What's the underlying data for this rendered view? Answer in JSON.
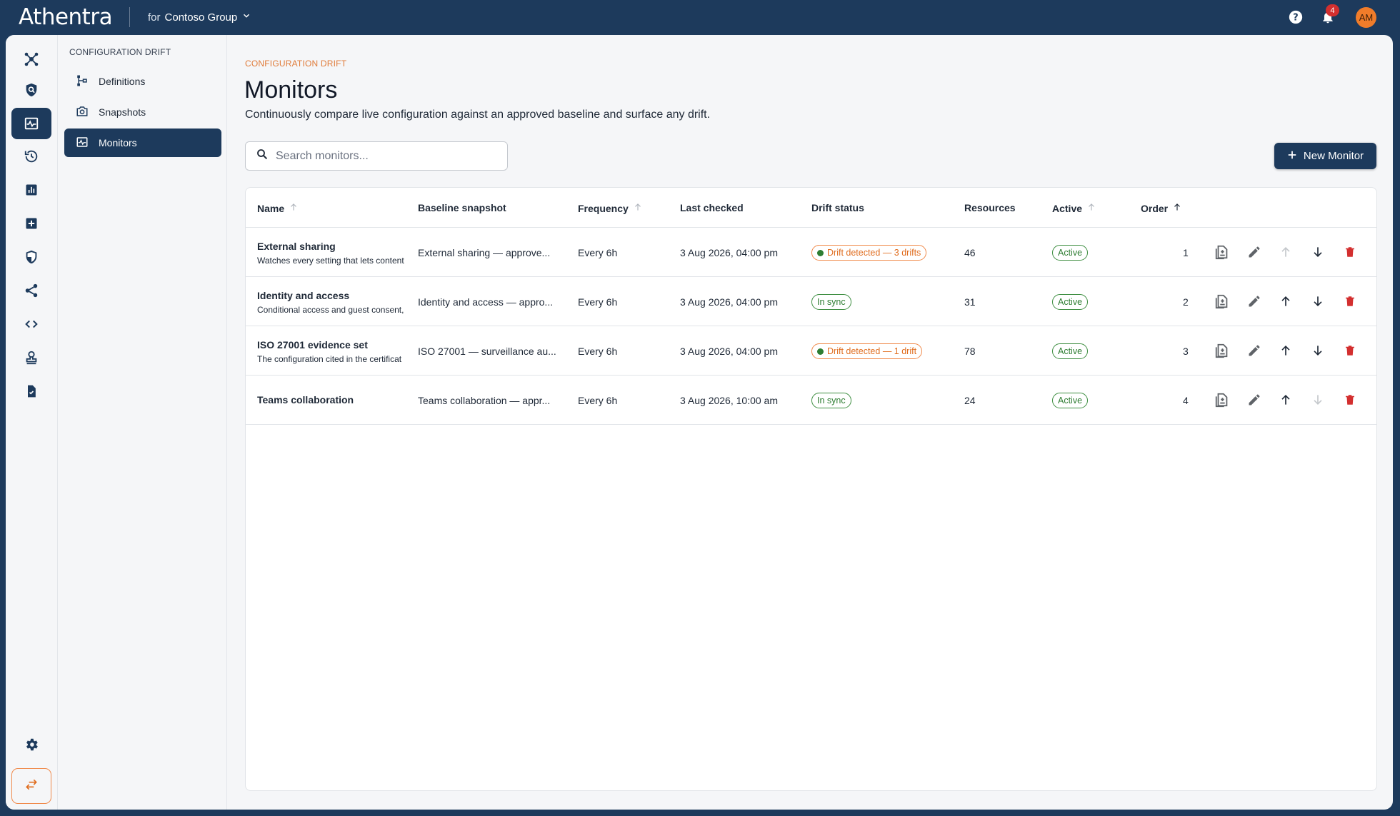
{
  "topbar": {
    "logo": "Athentra",
    "tenant_prefix": "for",
    "tenant_name": "Contoso Group",
    "notification_count": "4",
    "avatar_initials": "AM",
    "icons": [
      "help-icon",
      "bell-icon",
      "chevron-down-icon"
    ]
  },
  "rail": {
    "items": [
      "hub-icon",
      "shield-search-icon",
      "monitor-icon",
      "history-icon",
      "bar-chart-icon",
      "add-box-icon",
      "security-icon",
      "share-icon",
      "code-icon",
      "stamp-icon",
      "task-icon"
    ],
    "active_index": 2,
    "bottom_icons": [
      "settings-icon",
      "swap-icon"
    ]
  },
  "subnav": {
    "title": "CONFIGURATION DRIFT",
    "items": [
      {
        "label": "Definitions",
        "icon": "tree-icon"
      },
      {
        "label": "Snapshots",
        "icon": "camera-icon"
      },
      {
        "label": "Monitors",
        "icon": "monitor-icon",
        "active": true
      }
    ]
  },
  "main": {
    "breadcrumb": "CONFIGURATION DRIFT",
    "title": "Monitors",
    "subtitle": "Continuously compare live configuration against an approved baseline and surface any drift.",
    "search_placeholder": "Search monitors...",
    "new_button": "New Monitor"
  },
  "table": {
    "columns": [
      "Name",
      "Baseline snapshot",
      "Frequency",
      "Last checked",
      "Drift status",
      "Resources",
      "Active",
      "Order"
    ],
    "rows": [
      {
        "name": "External sharing",
        "desc": "Watches every setting that lets content",
        "baseline": "External sharing — approve...",
        "frequency": "Every 6h",
        "last_checked": "3 Aug 2026, 04:00 pm",
        "drift": "Drift detected — 3 drifts",
        "drift_state": "drift",
        "resources": "46",
        "active": "Active",
        "order": "1",
        "up_enabled": false,
        "down_enabled": true
      },
      {
        "name": "Identity and access",
        "desc": "Conditional access and guest consent,",
        "baseline": "Identity and access — appro...",
        "frequency": "Every 6h",
        "last_checked": "3 Aug 2026, 04:00 pm",
        "drift": "In sync",
        "drift_state": "sync",
        "resources": "31",
        "active": "Active",
        "order": "2",
        "up_enabled": true,
        "down_enabled": true
      },
      {
        "name": "ISO 27001 evidence set",
        "desc": "The configuration cited in the certificat",
        "baseline": "ISO 27001 — surveillance au...",
        "frequency": "Every 6h",
        "last_checked": "3 Aug 2026, 04:00 pm",
        "drift": "Drift detected — 1 drift",
        "drift_state": "drift",
        "resources": "78",
        "active": "Active",
        "order": "3",
        "up_enabled": true,
        "down_enabled": true
      },
      {
        "name": "Teams collaboration",
        "desc": "",
        "baseline": "Teams collaboration — appr...",
        "frequency": "Every 6h",
        "last_checked": "3 Aug 2026, 10:00 am",
        "drift": "In sync",
        "drift_state": "sync",
        "resources": "24",
        "active": "Active",
        "order": "4",
        "up_enabled": true,
        "down_enabled": false
      }
    ]
  },
  "colors": {
    "navy": "#1d3a5c",
    "orange": "#f08a4b",
    "green": "#2e7d32",
    "delete_red": "#d32f2f"
  }
}
